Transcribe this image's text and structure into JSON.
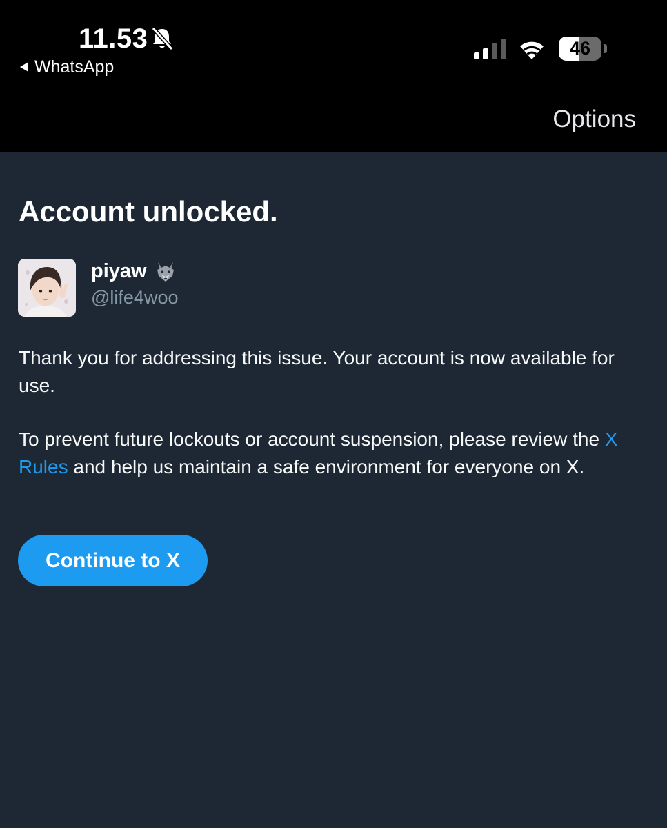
{
  "status_bar": {
    "time": "11.53",
    "back_app": "WhatsApp",
    "battery": "46",
    "battery_level": 0.46,
    "icons": [
      "bell-slash-icon",
      "signal-icon",
      "wifi-icon",
      "battery-icon",
      "back-triangle-icon"
    ]
  },
  "nav": {
    "options_label": "Options"
  },
  "content": {
    "title": "Account unlocked.",
    "user": {
      "display_name": "piyaw",
      "handle": "@life4woo",
      "emoji": "wolf-emoji-icon"
    },
    "paragraph1": "Thank you for addressing this issue. Your account is now available for use.",
    "paragraph2_before": "To prevent future lockouts or account suspension, please review the ",
    "paragraph2_link": "X Rules",
    "paragraph2_after": " and help us maintain a safe environment for everyone on X.",
    "continue_label": "Continue to X"
  },
  "colors": {
    "background": "#1e2834",
    "top_bar": "#000000",
    "accent": "#1d9bf0",
    "secondary_text": "#8899a6"
  }
}
